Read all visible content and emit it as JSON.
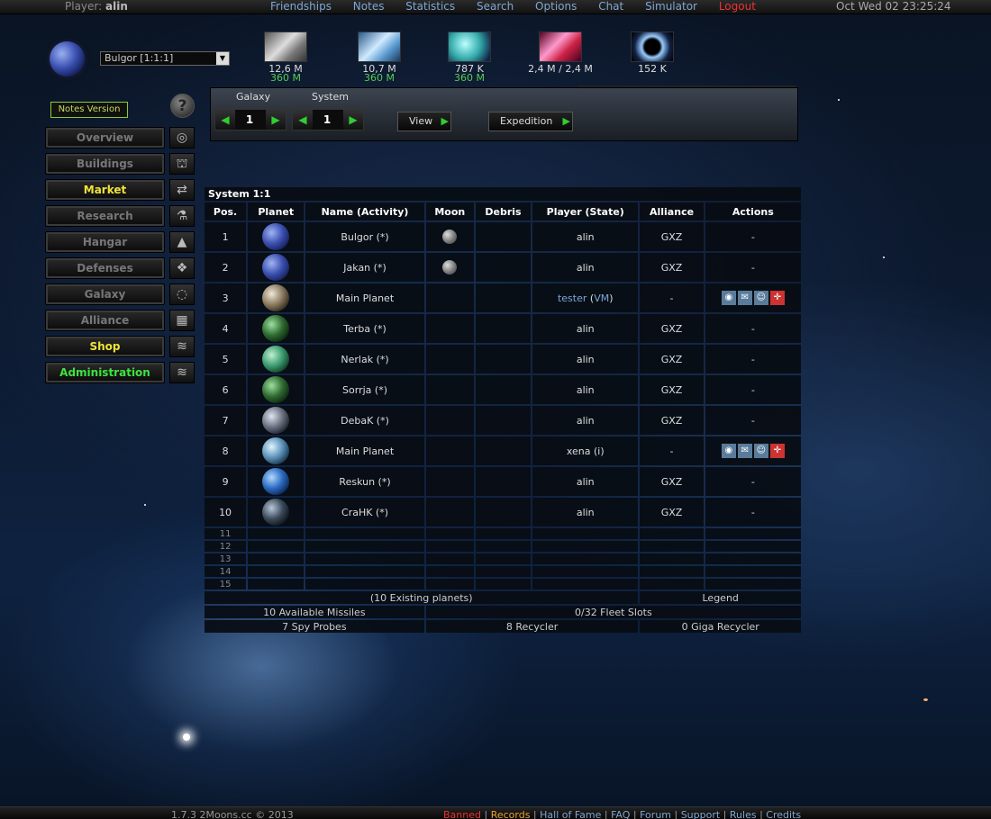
{
  "topbar": {
    "player_label": "Player:",
    "player_name": "alin",
    "menu": [
      "Friendships",
      "Notes",
      "Statistics",
      "Search",
      "Options",
      "Chat",
      "Simulator",
      "Logout"
    ],
    "clock": "Oct Wed 02 23:25:24"
  },
  "planet_selector": {
    "value": "Bulgor [1:1:1]"
  },
  "resources": [
    {
      "name": "metal",
      "value": "12,6 M",
      "production": "360 M"
    },
    {
      "name": "crystal",
      "value": "10,7 M",
      "production": "360 M"
    },
    {
      "name": "deuterium",
      "value": "787 K",
      "production": "360 M"
    },
    {
      "name": "energy",
      "value": "2,4 M / 2,4 M",
      "production": ""
    },
    {
      "name": "dark-matter",
      "value": "152 K",
      "production": ""
    }
  ],
  "notes_version": "Notes Version",
  "nav": [
    {
      "label": "Overview",
      "icon": "◎"
    },
    {
      "label": "Buildings",
      "icon": "⛫"
    },
    {
      "label": "Market",
      "icon": "⇄"
    },
    {
      "label": "Research",
      "icon": "⚗"
    },
    {
      "label": "Hangar",
      "icon": "▲"
    },
    {
      "label": "Defenses",
      "icon": "❖"
    },
    {
      "label": "Galaxy",
      "icon": "◌"
    },
    {
      "label": "Alliance",
      "icon": "▦"
    },
    {
      "label": "Shop",
      "icon": "≋"
    },
    {
      "label": "Administration",
      "icon": "≋"
    }
  ],
  "galaxy_nav": {
    "galaxy_label": "Galaxy",
    "galaxy_value": "1",
    "system_label": "System",
    "system_value": "1",
    "view_button": "View",
    "expedition_button": "Expedition"
  },
  "table": {
    "title": "System 1:1",
    "headers": [
      "Pos.",
      "Planet",
      "Name (Activity)",
      "Moon",
      "Debris",
      "Player (State)",
      "Alliance",
      "Actions"
    ],
    "rows": [
      {
        "pos": "1",
        "name": "Bulgor (*)",
        "moon": true,
        "player": "alin",
        "alliance": "GXZ",
        "action": "-"
      },
      {
        "pos": "2",
        "name": "Jakan (*)",
        "moon": true,
        "player": "alin",
        "alliance": "GXZ",
        "action": "-"
      },
      {
        "pos": "3",
        "name": "Main Planet",
        "moon": false,
        "player": "tester",
        "state": "VM",
        "alliance": "-",
        "icons": true
      },
      {
        "pos": "4",
        "name": "Terba (*)",
        "moon": false,
        "player": "alin",
        "alliance": "GXZ",
        "action": "-"
      },
      {
        "pos": "5",
        "name": "Nerlak (*)",
        "moon": false,
        "player": "alin",
        "alliance": "GXZ",
        "action": "-"
      },
      {
        "pos": "6",
        "name": "Sorrja (*)",
        "moon": false,
        "player": "alin",
        "alliance": "GXZ",
        "action": "-"
      },
      {
        "pos": "7",
        "name": "DebaK (*)",
        "moon": false,
        "player": "alin",
        "alliance": "GXZ",
        "action": "-"
      },
      {
        "pos": "8",
        "name": "Main Planet",
        "moon": false,
        "player": "xena (i)",
        "alliance": "-",
        "icons": true
      },
      {
        "pos": "9",
        "name": "Reskun (*)",
        "moon": false,
        "player": "alin",
        "alliance": "GXZ",
        "action": "-"
      },
      {
        "pos": "10",
        "name": "CraHK (*)",
        "moon": false,
        "player": "alin",
        "alliance": "GXZ",
        "action": "-"
      }
    ],
    "empty_rows": [
      "11",
      "12",
      "13",
      "14",
      "15"
    ],
    "existing": "(10 Existing planets)",
    "legend": "Legend",
    "missiles": "10 Available Missiles",
    "fleet_slots": "0/32 Fleet Slots",
    "spy_probes": "7 Spy Probes",
    "recycler": "8 Recycler",
    "giga_recycler": "0 Giga Recycler"
  },
  "footer": {
    "version": "1.7.3 2Moons.cc © 2013",
    "links": [
      "Banned",
      "Records",
      "Hall of Fame",
      "FAQ",
      "Forum",
      "Support",
      "Rules",
      "Credits"
    ]
  }
}
